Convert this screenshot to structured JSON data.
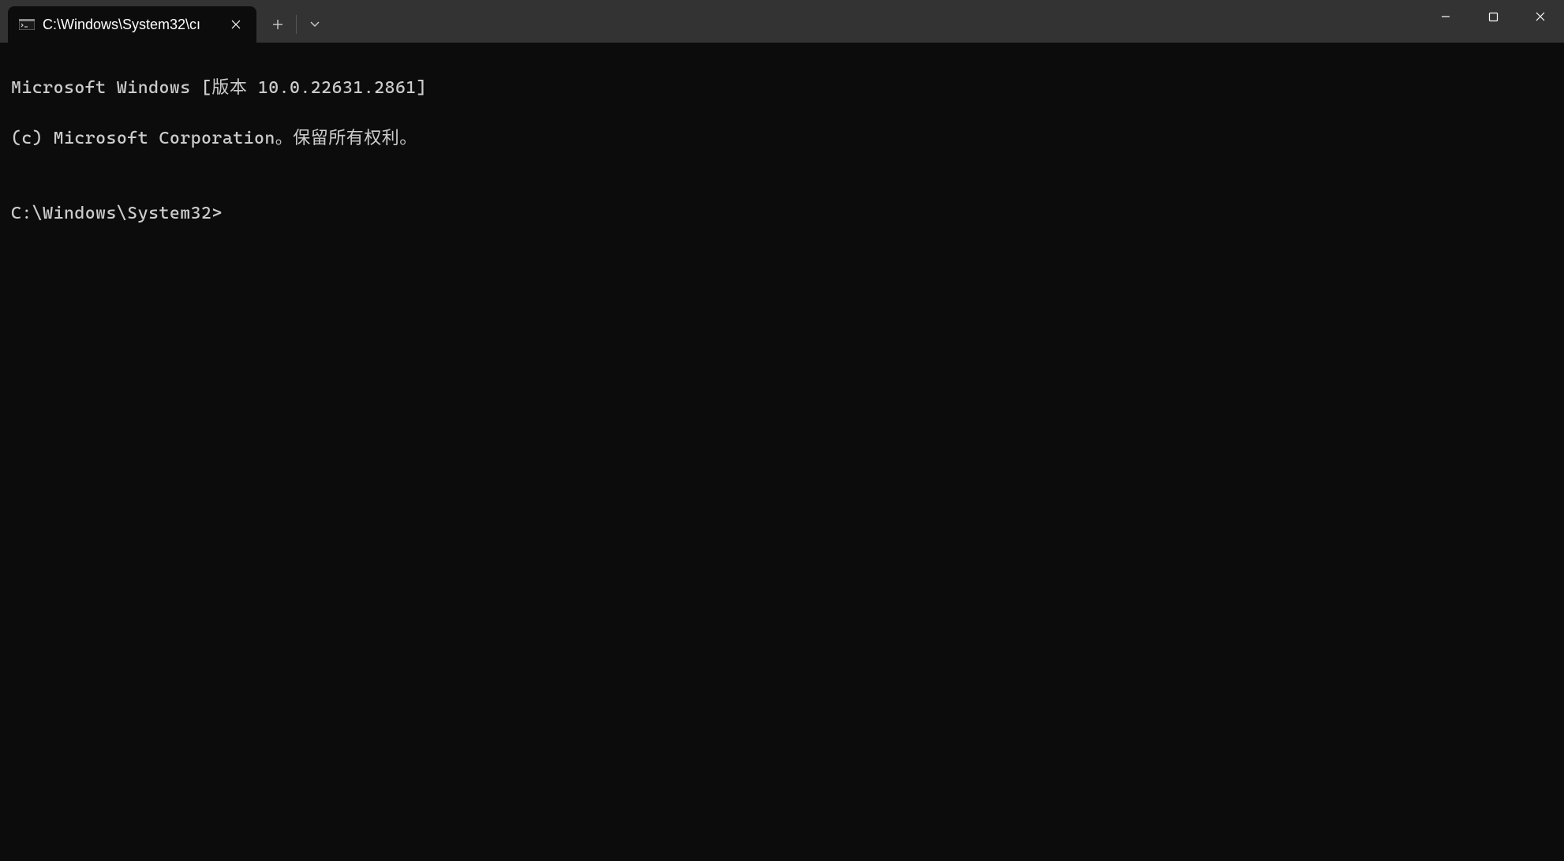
{
  "titlebar": {
    "tab_title": "C:\\Windows\\System32\\cı"
  },
  "terminal": {
    "line1": "Microsoft Windows [版本 10.0.22631.2861]",
    "line2": "(c) Microsoft Corporation。保留所有权利。",
    "blank": "",
    "prompt": "C:\\Windows\\System32>"
  }
}
